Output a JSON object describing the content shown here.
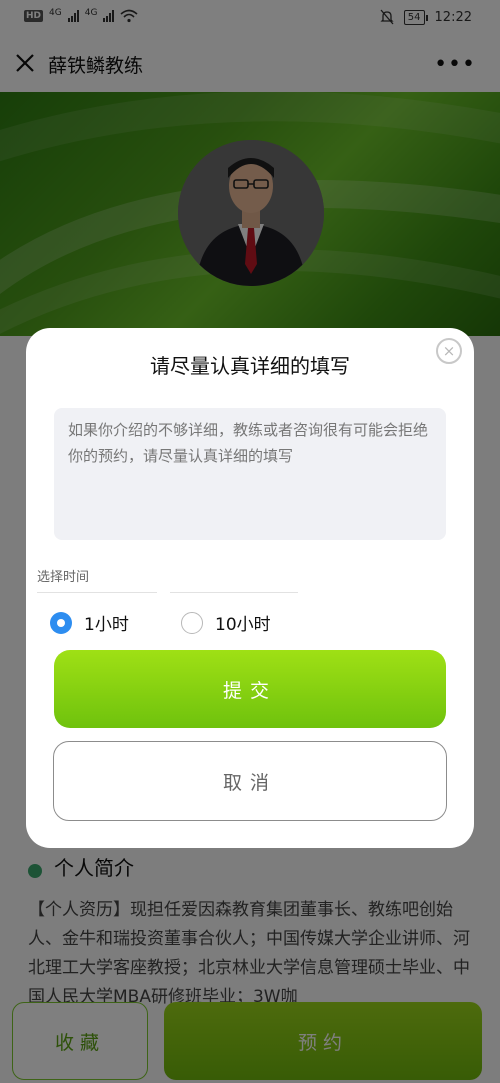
{
  "status_bar": {
    "hd": "HD",
    "signal1": "4G",
    "signal2": "4G",
    "battery": "54",
    "time": "12:22"
  },
  "nav": {
    "title": "薛铁鳞教练",
    "more": "•••"
  },
  "modal": {
    "title": "请尽量认真详细的填写",
    "close_symbol": "×",
    "textarea_placeholder": "如果你介绍的不够详细，教练或者咨询很有可能会拒绝你的预约，请尽量认真详细的填写",
    "time_label": "选择时间",
    "options": [
      {
        "label": "1小时",
        "checked": true
      },
      {
        "label": "10小时",
        "checked": false
      }
    ],
    "submit_label": "提交",
    "cancel_label": "取消"
  },
  "background": {
    "section_title": "个人简介",
    "intro_text": "【个人资历】现担任爱因森教育集团董事长、教练吧创始人、金牛和瑞投资董事合伙人；中国传媒大学企业讲师、河北理工大学客座教授；北京林业大学信息管理硕士毕业、中国人民大学MBA研修班毕业；3W咖",
    "favorite_label": "收藏",
    "book_label": "预约"
  },
  "colors": {
    "accent_green": "#7cc91a",
    "radio_blue": "#2d8df0",
    "banner_green": "#4f9e1c"
  },
  "icons": {
    "close": "close-icon",
    "more": "more-icon",
    "wifi": "wifi-icon",
    "mute": "bell-off-icon"
  }
}
